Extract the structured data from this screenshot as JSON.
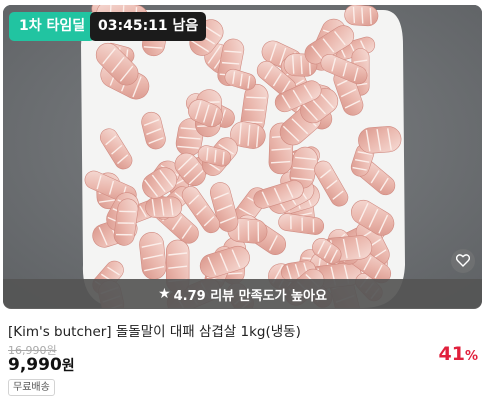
{
  "badges": {
    "deal": "1차 타임딜",
    "timer": "03:45:11 남음"
  },
  "image": {
    "alt": "Rolled pork belly slices on a white plate"
  },
  "icons": {
    "wish": "heart-icon",
    "star": "star-icon"
  },
  "rating": {
    "star": "★",
    "text": "4.79 리뷰 만족도가 높아요"
  },
  "product": {
    "title": "[Kim's butcher] 돌돌말이 대패 삼겹살 1kg(냉동)",
    "original_price": "16,990원",
    "price": "9,990",
    "price_unit": "원",
    "discount": "41",
    "discount_unit": "%",
    "shipping": "무료배송"
  },
  "colors": {
    "deal_badge": "#21c4a1",
    "timer_badge": "#1b1b1b",
    "discount": "#e0203c"
  }
}
